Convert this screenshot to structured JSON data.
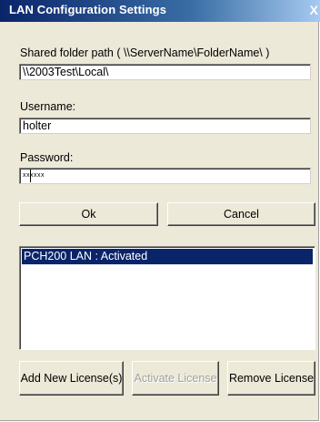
{
  "window": {
    "title": "LAN Configuration Settings",
    "close_glyph": "X"
  },
  "form": {
    "shared_folder": {
      "label": "Shared folder path ( \\\\ServerName\\FolderName\\ )",
      "value": "\\\\2003Test\\Local\\"
    },
    "username": {
      "label": "Username:",
      "value": "holter"
    },
    "password": {
      "label": "Password:",
      "value": "xxxxxx"
    }
  },
  "buttons": {
    "ok": "Ok",
    "cancel": "Cancel",
    "add_new_license": "Add New License(s)",
    "activate_license": "Activate License",
    "remove_license": "Remove License"
  },
  "license_list": {
    "items": [
      "PCH200 LAN : Activated"
    ],
    "selected_index": 0
  },
  "colors": {
    "face": "#ece9d8",
    "selection": "#0a246a",
    "title_start": "#0a246a",
    "title_end": "#a6caf0"
  }
}
